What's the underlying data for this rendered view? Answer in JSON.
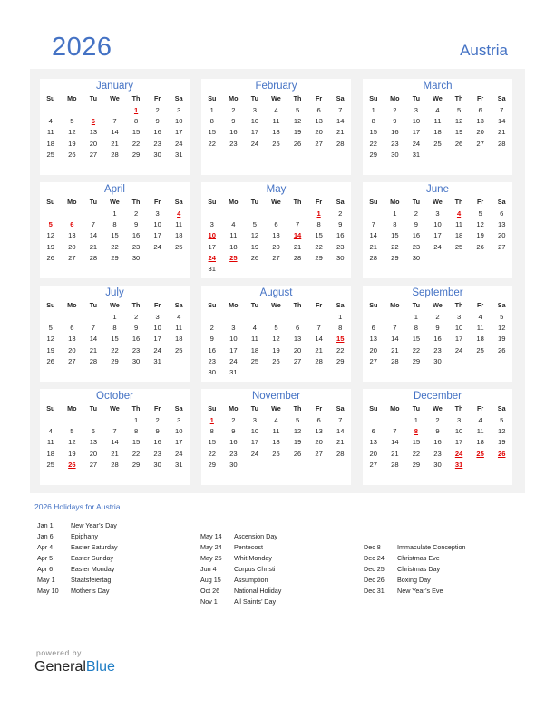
{
  "header": {
    "year": "2026",
    "country": "Austria"
  },
  "weekdays": [
    "Su",
    "Mo",
    "Tu",
    "We",
    "Th",
    "Fr",
    "Sa"
  ],
  "months": [
    {
      "name": "January",
      "start": 4,
      "days": 31,
      "holidays": [
        1,
        6
      ]
    },
    {
      "name": "February",
      "start": 0,
      "days": 28,
      "holidays": []
    },
    {
      "name": "March",
      "start": 0,
      "days": 31,
      "holidays": []
    },
    {
      "name": "April",
      "start": 3,
      "days": 30,
      "holidays": [
        4,
        5,
        6
      ]
    },
    {
      "name": "May",
      "start": 5,
      "days": 31,
      "holidays": [
        1,
        10,
        14,
        24,
        25
      ]
    },
    {
      "name": "June",
      "start": 1,
      "days": 30,
      "holidays": [
        4
      ]
    },
    {
      "name": "July",
      "start": 3,
      "days": 31,
      "holidays": []
    },
    {
      "name": "August",
      "start": 6,
      "days": 31,
      "holidays": [
        15
      ]
    },
    {
      "name": "September",
      "start": 2,
      "days": 30,
      "holidays": []
    },
    {
      "name": "October",
      "start": 4,
      "days": 31,
      "holidays": [
        26
      ]
    },
    {
      "name": "November",
      "start": 0,
      "days": 30,
      "holidays": [
        1
      ]
    },
    {
      "name": "December",
      "start": 2,
      "days": 31,
      "holidays": [
        8,
        24,
        25,
        26,
        31
      ]
    }
  ],
  "holidays_title": "2026 Holidays for Austria",
  "holiday_columns": [
    [
      {
        "date": "Jan 1",
        "name": "New Year’s Day"
      },
      {
        "date": "Jan 6",
        "name": "Epiphany"
      },
      {
        "date": "Apr 4",
        "name": "Easter Saturday"
      },
      {
        "date": "Apr 5",
        "name": "Easter Sunday"
      },
      {
        "date": "Apr 6",
        "name": "Easter Monday"
      },
      {
        "date": "May 1",
        "name": "Staatsfeiertag"
      },
      {
        "date": "May 10",
        "name": "Mother’s Day"
      }
    ],
    [
      {
        "date": "May 14",
        "name": "Ascension Day"
      },
      {
        "date": "May 24",
        "name": "Pentecost"
      },
      {
        "date": "May 25",
        "name": "Whit Monday"
      },
      {
        "date": "Jun 4",
        "name": "Corpus Christi"
      },
      {
        "date": "Aug 15",
        "name": "Assumption"
      },
      {
        "date": "Oct 26",
        "name": "National Holiday"
      },
      {
        "date": "Nov 1",
        "name": "All Saints’ Day"
      }
    ],
    [
      {
        "date": "Dec 8",
        "name": "Immaculate Conception"
      },
      {
        "date": "Dec 24",
        "name": "Christmas Eve"
      },
      {
        "date": "Dec 25",
        "name": "Christmas Day"
      },
      {
        "date": "Dec 26",
        "name": "Boxing Day"
      },
      {
        "date": "Dec 31",
        "name": "New Year’s Eve"
      }
    ]
  ],
  "footer": {
    "powered_by": "powered by",
    "brand_general": "General",
    "brand_blue": "Blue"
  }
}
